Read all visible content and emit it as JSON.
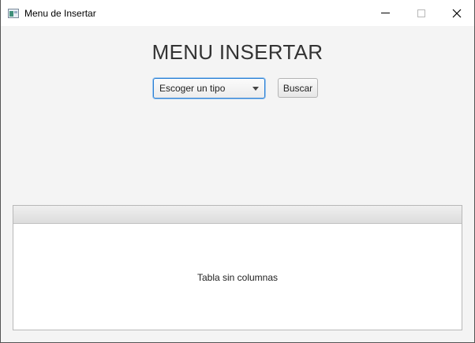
{
  "window": {
    "title": "Menu de Insertar",
    "icon": "app-window-icon"
  },
  "main": {
    "heading": "MENU INSERTAR",
    "type_select": {
      "selected": "Escoger un tipo",
      "icon": "chevron-down-icon"
    },
    "search_button": "Buscar"
  },
  "table": {
    "columns": [],
    "rows": [],
    "empty_message": "Tabla sin columnas"
  },
  "colors": {
    "focus_accent": "#2a7fd4",
    "background": "#f4f4f4"
  }
}
